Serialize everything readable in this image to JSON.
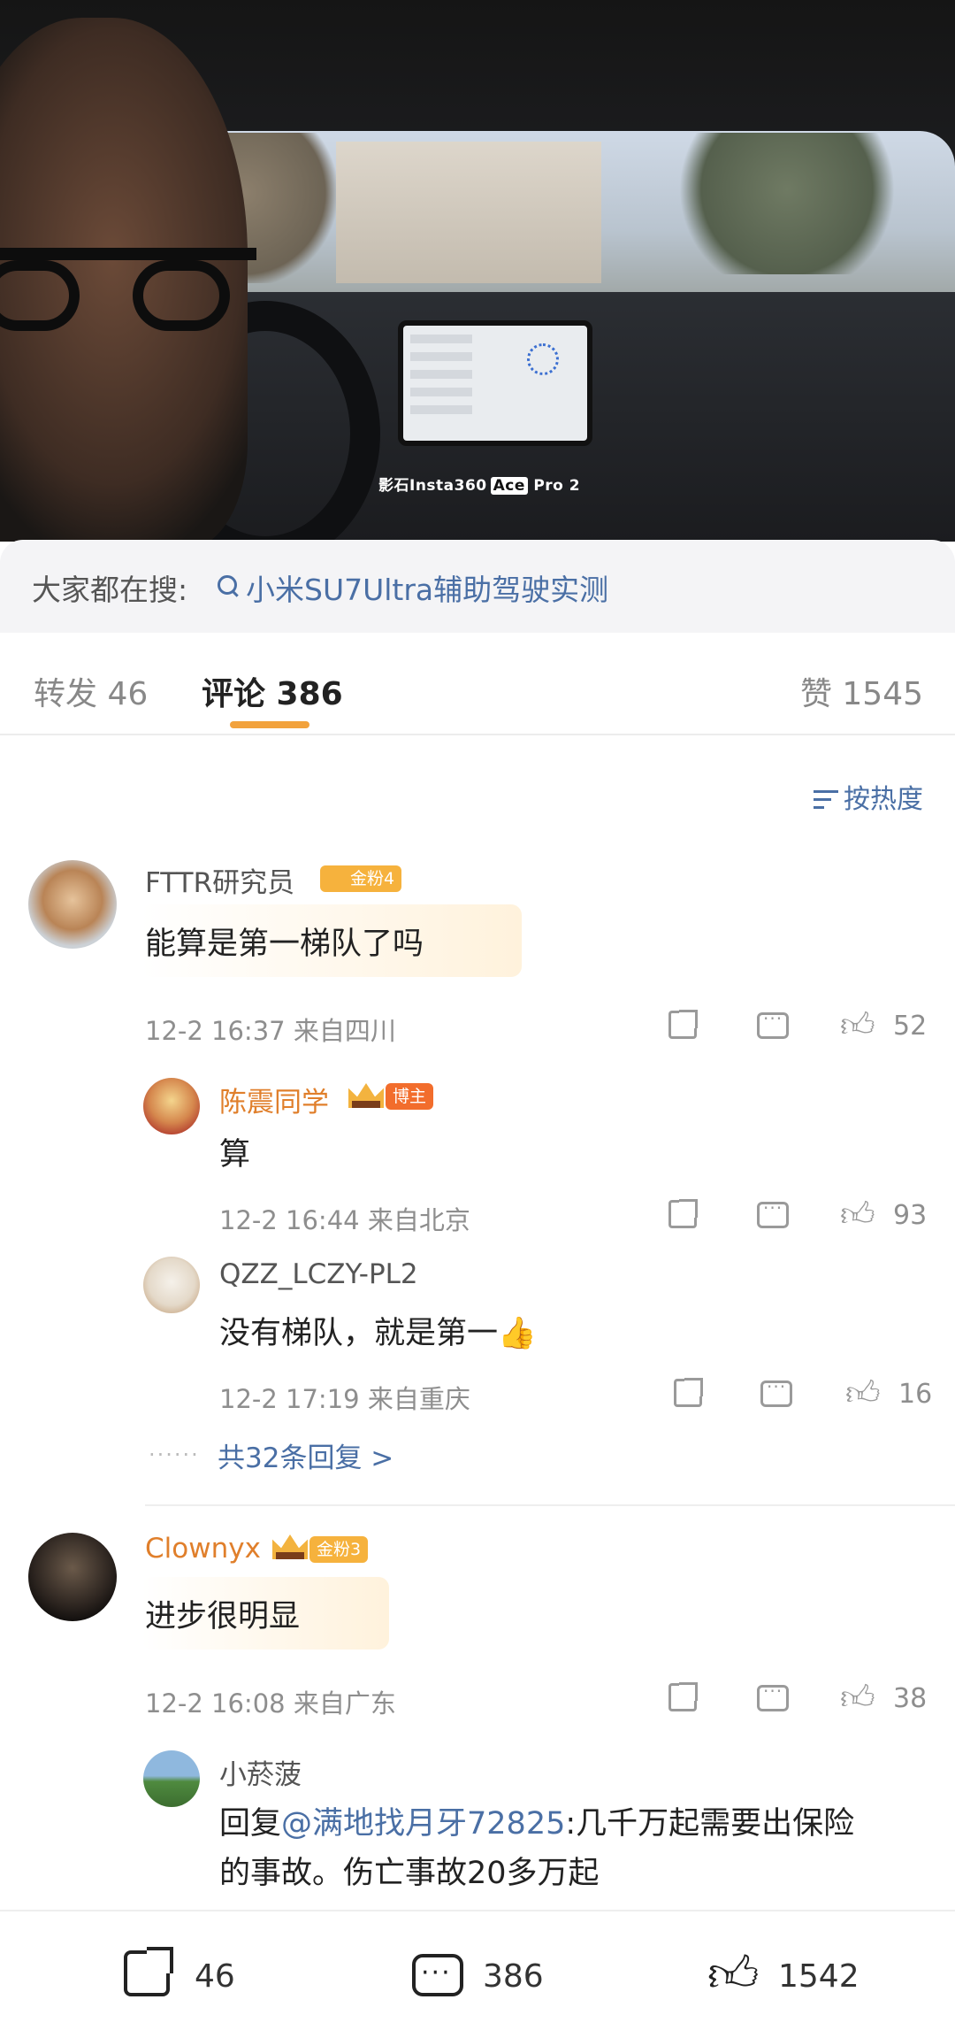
{
  "video": {
    "watermark_prefix": "影石Insta360",
    "watermark_ace": "Ace",
    "watermark_suffix": "Pro 2"
  },
  "search": {
    "label": "大家都在搜:",
    "link": "小米SU7Ultra辅助驾驶实测"
  },
  "tabs": [
    {
      "label": "转发 46"
    },
    {
      "label": "评论 386"
    },
    {
      "label": "赞 1545"
    }
  ],
  "sort": {
    "label": "按热度"
  },
  "comments": [
    {
      "user": "FTTR研究员",
      "badge": "金粉4",
      "text": "能算是第一梯队了吗",
      "meta": "12-2 16:37  来自四川",
      "likes": "52",
      "replies": [
        {
          "user": "陈震同学",
          "badge": "博主",
          "text": "算",
          "meta": "12-2 16:44  来自北京",
          "likes": "93"
        },
        {
          "user": "QZZ_LCZY-PL2",
          "text": "没有梯队，就是第一👍",
          "meta": "12-2 17:19  来自重庆",
          "likes": "16"
        }
      ],
      "more": "共32条回复 >"
    },
    {
      "user": "Clownyx",
      "badge": "金粉3",
      "text": "进步很明显",
      "meta": "12-2 16:08  来自广东",
      "likes": "38",
      "replies": [
        {
          "user": "小菸菠",
          "prefix": "回复",
          "mention": "@满地找月牙72825",
          "text": ":几千万起需要出保险",
          "text2": "的事故。伤亡事故20多万起"
        }
      ]
    }
  ],
  "bottom": {
    "share": "46",
    "comment": "386",
    "like": "1542"
  }
}
